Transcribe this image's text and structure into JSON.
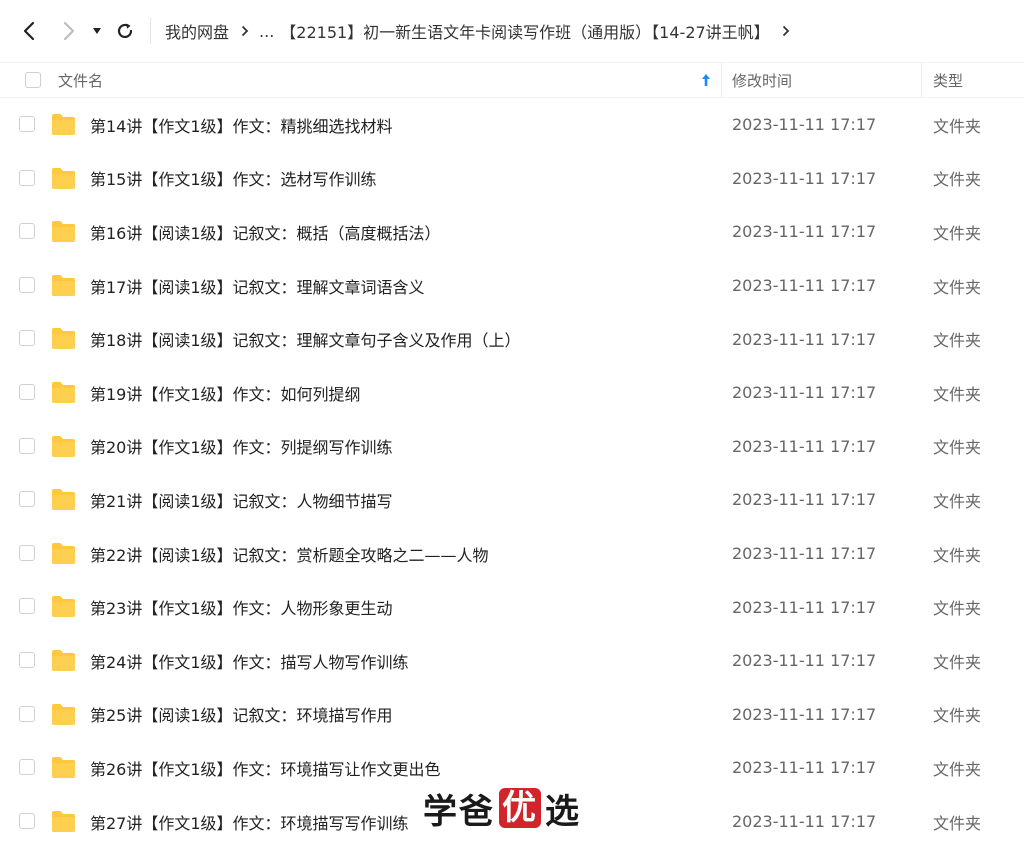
{
  "nav": {
    "back_icon": "chevron-left-icon",
    "forward_icon": "chevron-right-icon",
    "history_icon": "caret-down-icon",
    "refresh_icon": "refresh-icon",
    "breadcrumb": {
      "root": "我的网盘",
      "ellipsis": "...",
      "current": "【22151】初一新生语文年卡阅读写作班（通用版）【14-27讲王帆】"
    }
  },
  "table": {
    "columns": {
      "name": "文件名",
      "modified": "修改时间",
      "type": "类型"
    },
    "sort_icon": "arrow-up-icon",
    "sort_color": "#1a8cff",
    "folder_color": "#ffc83d",
    "rows": [
      {
        "name": "第14讲【作文1级】作文：精挑细选找材料",
        "modified": "2023-11-11 17:17",
        "type": "文件夹"
      },
      {
        "name": "第15讲【作文1级】作文：选材写作训练",
        "modified": "2023-11-11 17:17",
        "type": "文件夹"
      },
      {
        "name": "第16讲【阅读1级】记叙文：概括（高度概括法）",
        "modified": "2023-11-11 17:17",
        "type": "文件夹"
      },
      {
        "name": "第17讲【阅读1级】记叙文：理解文章词语含义",
        "modified": "2023-11-11 17:17",
        "type": "文件夹"
      },
      {
        "name": "第18讲【阅读1级】记叙文：理解文章句子含义及作用（上）",
        "modified": "2023-11-11 17:17",
        "type": "文件夹"
      },
      {
        "name": "第19讲【作文1级】作文：如何列提纲",
        "modified": "2023-11-11 17:17",
        "type": "文件夹"
      },
      {
        "name": "第20讲【作文1级】作文：列提纲写作训练",
        "modified": "2023-11-11 17:17",
        "type": "文件夹"
      },
      {
        "name": "第21讲【阅读1级】记叙文：人物细节描写",
        "modified": "2023-11-11 17:17",
        "type": "文件夹"
      },
      {
        "name": "第22讲【阅读1级】记叙文：赏析题全攻略之二——人物",
        "modified": "2023-11-11 17:17",
        "type": "文件夹"
      },
      {
        "name": "第23讲【作文1级】作文：人物形象更生动",
        "modified": "2023-11-11 17:17",
        "type": "文件夹"
      },
      {
        "name": "第24讲【作文1级】作文：描写人物写作训练",
        "modified": "2023-11-11 17:17",
        "type": "文件夹"
      },
      {
        "name": "第25讲【阅读1级】记叙文：环境描写作用",
        "modified": "2023-11-11 17:17",
        "type": "文件夹"
      },
      {
        "name": "第26讲【作文1级】作文：环境描写让作文更出色",
        "modified": "2023-11-11 17:17",
        "type": "文件夹"
      },
      {
        "name": "第27讲【作文1级】作文：环境描写写作训练",
        "modified": "2023-11-11 17:17",
        "type": "文件夹"
      }
    ]
  },
  "watermark": {
    "part1": "学爸",
    "highlight": "优",
    "part2": "选",
    "highlight_color": "#d2242b"
  }
}
